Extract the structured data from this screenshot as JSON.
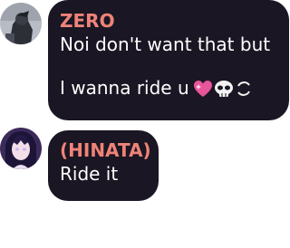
{
  "messages": [
    {
      "sender": "ZERO",
      "lines": [
        "Noi don't want that but",
        "I wanna ride u"
      ],
      "emojis": [
        "sparkling-heart",
        "skull",
        "circle-arrows"
      ]
    },
    {
      "sender": "(HINATA)",
      "lines": [
        "Ride it"
      ]
    }
  ],
  "colors": {
    "bubble": "#1a1623",
    "sender": "#ee8378",
    "text": "#ffffff"
  }
}
